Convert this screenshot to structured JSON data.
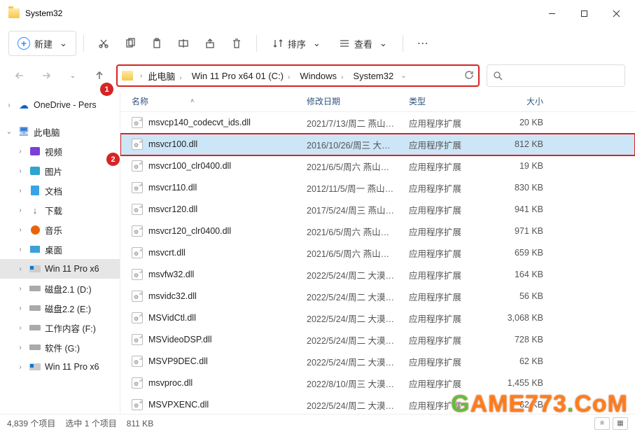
{
  "title": "System32",
  "toolbar": {
    "new": "新建",
    "sort": "排序",
    "view": "查看"
  },
  "breadcrumbs": [
    "此电脑",
    "Win 11 Pro x64 01 (C:)",
    "Windows",
    "System32"
  ],
  "search_placeholder": "",
  "sidebar": [
    {
      "label": "OneDrive - Pers",
      "icon": "cloud",
      "indent": 0,
      "exp": ">"
    },
    {
      "gap": true
    },
    {
      "label": "此电脑",
      "icon": "pc",
      "indent": 0,
      "exp": "v"
    },
    {
      "label": "视频",
      "icon": "video",
      "indent": 1,
      "exp": ">"
    },
    {
      "label": "图片",
      "icon": "pictures",
      "indent": 1,
      "exp": ">"
    },
    {
      "label": "文档",
      "icon": "docs",
      "indent": 1,
      "exp": ">"
    },
    {
      "label": "下载",
      "icon": "download",
      "indent": 1,
      "exp": ">"
    },
    {
      "label": "音乐",
      "icon": "music",
      "indent": 1,
      "exp": ">"
    },
    {
      "label": "桌面",
      "icon": "desktop",
      "indent": 1,
      "exp": ">"
    },
    {
      "label": "Win 11 Pro x6",
      "icon": "drive-win",
      "indent": 1,
      "exp": ">",
      "selected": true
    },
    {
      "label": "磁盘2.1 (D:)",
      "icon": "drive",
      "indent": 1,
      "exp": ">"
    },
    {
      "label": "磁盘2.2 (E:)",
      "icon": "drive",
      "indent": 1,
      "exp": ">"
    },
    {
      "label": "工作内容 (F:)",
      "icon": "drive",
      "indent": 1,
      "exp": ">"
    },
    {
      "label": "软件 (G:)",
      "icon": "drive",
      "indent": 1,
      "exp": ">"
    },
    {
      "label": "Win 11 Pro x6",
      "icon": "drive-win",
      "indent": 1,
      "exp": ">"
    }
  ],
  "columns": {
    "name": "名称",
    "date": "修改日期",
    "type": "类型",
    "size": "大小"
  },
  "files": [
    {
      "name": "msvcp140_codecvt_ids.dll",
      "date": "2021/7/13/周二 燕山…",
      "type": "应用程序扩展",
      "size": "20 KB"
    },
    {
      "name": "msvcr100.dll",
      "date": "2016/10/26/周三 大…",
      "type": "应用程序扩展",
      "size": "812 KB",
      "selected": true
    },
    {
      "name": "msvcr100_clr0400.dll",
      "date": "2021/6/5/周六 燕山月…",
      "type": "应用程序扩展",
      "size": "19 KB"
    },
    {
      "name": "msvcr110.dll",
      "date": "2012/11/5/周一 燕山…",
      "type": "应用程序扩展",
      "size": "830 KB"
    },
    {
      "name": "msvcr120.dll",
      "date": "2017/5/24/周三 燕山…",
      "type": "应用程序扩展",
      "size": "941 KB"
    },
    {
      "name": "msvcr120_clr0400.dll",
      "date": "2021/6/5/周六 燕山月…",
      "type": "应用程序扩展",
      "size": "971 KB"
    },
    {
      "name": "msvcrt.dll",
      "date": "2021/6/5/周六 燕山月…",
      "type": "应用程序扩展",
      "size": "659 KB"
    },
    {
      "name": "msvfw32.dll",
      "date": "2022/5/24/周二 大漠…",
      "type": "应用程序扩展",
      "size": "164 KB"
    },
    {
      "name": "msvidc32.dll",
      "date": "2022/5/24/周二 大漠…",
      "type": "应用程序扩展",
      "size": "56 KB"
    },
    {
      "name": "MSVidCtl.dll",
      "date": "2022/5/24/周二 大漠…",
      "type": "应用程序扩展",
      "size": "3,068 KB"
    },
    {
      "name": "MSVideoDSP.dll",
      "date": "2022/5/24/周二 大漠…",
      "type": "应用程序扩展",
      "size": "728 KB"
    },
    {
      "name": "MSVP9DEC.dll",
      "date": "2022/5/24/周二 大漠…",
      "type": "应用程序扩展",
      "size": "62 KB"
    },
    {
      "name": "msvproc.dll",
      "date": "2022/8/10/周三 大漠…",
      "type": "应用程序扩展",
      "size": "1,455 KB"
    },
    {
      "name": "MSVPXENC.dll",
      "date": "2022/5/24/周二 大漠…",
      "type": "应用程序扩展",
      "size": "62 KB"
    }
  ],
  "status": {
    "count": "4,839 个项目",
    "selected": "选中 1 个项目",
    "size": "811 KB"
  },
  "watermark": "GAME773.COM",
  "annotations": {
    "a1": "1",
    "a2": "2"
  }
}
